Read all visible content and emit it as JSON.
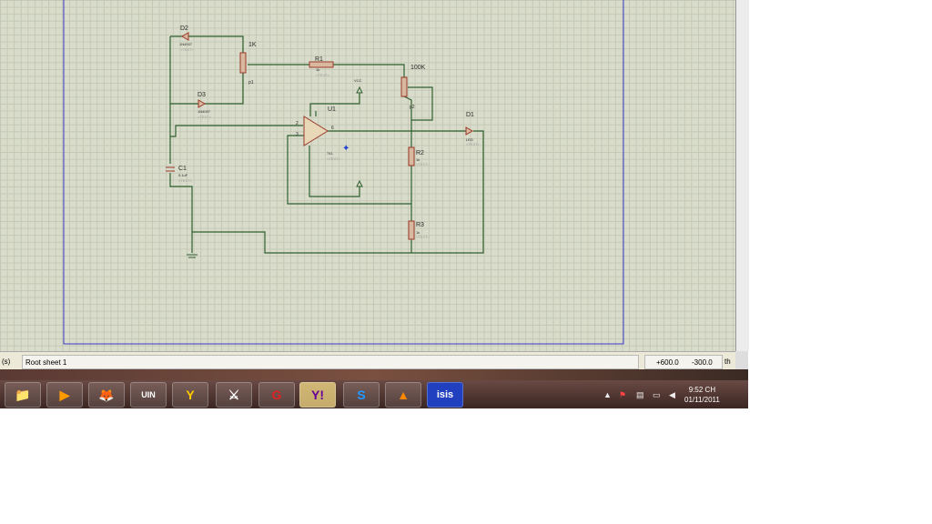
{
  "schematic": {
    "components": [
      {
        "ref": "D2",
        "value": "1N4007"
      },
      {
        "ref": "D3",
        "value": "1N4007"
      },
      {
        "ref": "R1",
        "value": "1k"
      },
      {
        "ref": "p1",
        "value": "1K"
      },
      {
        "ref": "p2",
        "value": "100K"
      },
      {
        "ref": "U1",
        "value": "741"
      },
      {
        "ref": "D1",
        "value": "LED"
      },
      {
        "ref": "R2",
        "value": "1k"
      },
      {
        "ref": "R3",
        "value": "1k"
      },
      {
        "ref": "C1",
        "value": "0.1uF"
      }
    ],
    "text_placeholder": "<TEXT>",
    "vcc_label": "VCC",
    "pins": {
      "inv": "2",
      "noninv": "3",
      "out": "6",
      "p4": "4",
      "p7": "7",
      "p1": "1"
    },
    "colors": {
      "wire": "#2f5f2f",
      "component": "#9b3a2a",
      "frame": "#3a3ac8",
      "background": "#d9dccb"
    }
  },
  "status_bar": {
    "left_fragment": "(s)",
    "sheet": "Root sheet 1",
    "x": "+600.0",
    "y": "-300.0",
    "units": "th"
  },
  "taskbar": {
    "apps": [
      {
        "name": "explorer",
        "glyph": "📁"
      },
      {
        "name": "media-player",
        "glyph": "▶"
      },
      {
        "name": "firefox",
        "glyph": "🦊"
      },
      {
        "name": "unikey",
        "glyph": "UIN"
      },
      {
        "name": "yahoo-messenger",
        "glyph": "Y"
      },
      {
        "name": "game",
        "glyph": "⚔"
      },
      {
        "name": "security",
        "glyph": "G"
      },
      {
        "name": "yahoo-messenger-active",
        "glyph": "Y!"
      },
      {
        "name": "skype",
        "glyph": "S"
      },
      {
        "name": "vlc",
        "glyph": "▲"
      },
      {
        "name": "isis",
        "glyph": "isis"
      }
    ],
    "clock_time": "9:52 CH",
    "clock_date": "01/11/2011"
  }
}
